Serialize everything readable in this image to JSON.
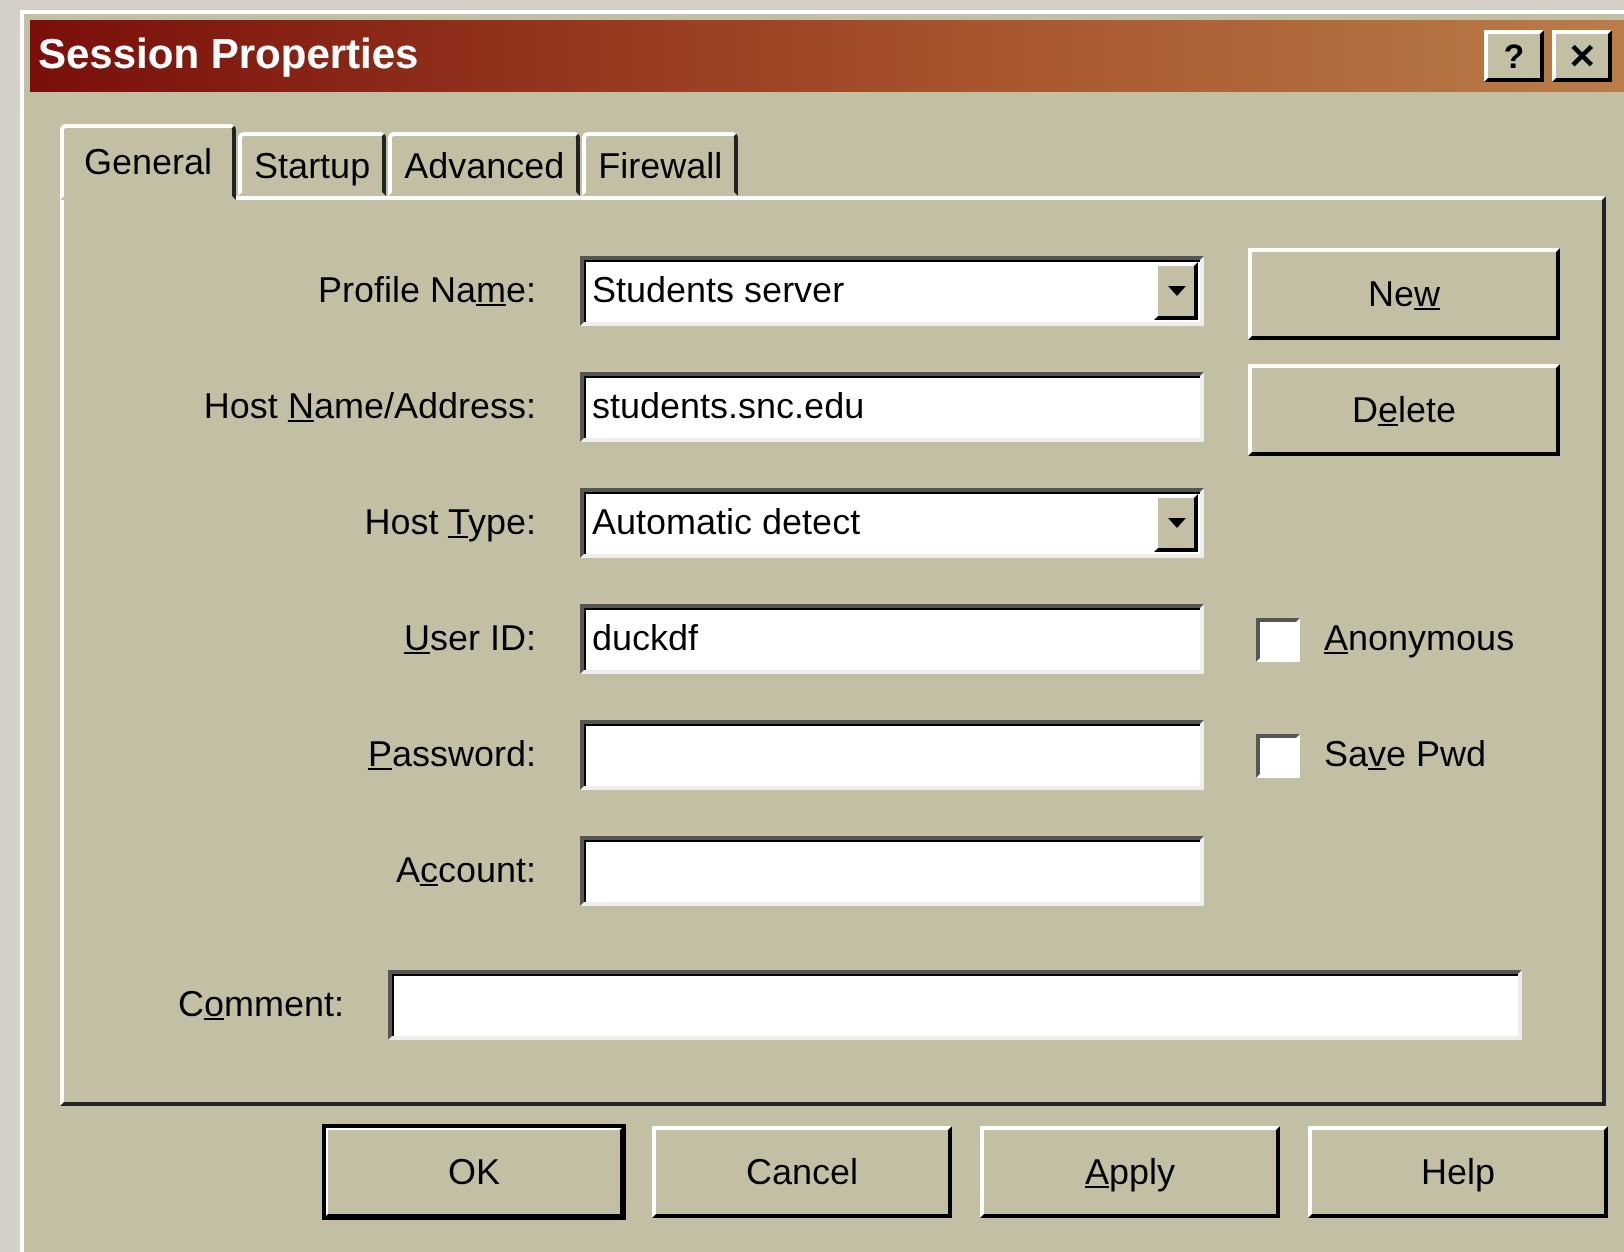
{
  "window": {
    "title": "Session Properties",
    "title_buttons": [
      "?",
      "✕"
    ]
  },
  "tabs": [
    {
      "label": "General",
      "selected": true
    },
    {
      "label": "Startup",
      "selected": false
    },
    {
      "label": "Advanced",
      "selected": false
    },
    {
      "label": "Firewall",
      "selected": false
    }
  ],
  "fields": [
    {
      "label": {
        "pre": "Profile Na",
        "key": "m",
        "post": "e:"
      },
      "kind": "combo",
      "value": "Students server"
    },
    {
      "label": {
        "pre": "Host ",
        "key": "N",
        "post": "ame/Address:"
      },
      "kind": "text",
      "value": "students.snc.edu"
    },
    {
      "label": {
        "pre": "Host ",
        "key": "T",
        "post": "ype:"
      },
      "kind": "combo",
      "value": "Automatic detect"
    },
    {
      "label": {
        "key": "U",
        "post": "ser ID:"
      },
      "kind": "text",
      "value": "duckdf"
    },
    {
      "label": {
        "key": "P",
        "post": "assword:"
      },
      "kind": "text"
    },
    {
      "label": {
        "pre": "A",
        "key": "c",
        "post": "count:"
      },
      "kind": "text"
    }
  ],
  "side_buttons": [
    {
      "label": {
        "pre": "Ne",
        "key": "w"
      }
    },
    {
      "label": {
        "pre": "D",
        "key": "e",
        "post": "lete"
      }
    }
  ],
  "checkboxes": [
    {
      "label": {
        "key": "A",
        "post": "nonymous"
      },
      "checked": false
    },
    {
      "label": {
        "pre": "Sa",
        "key": "v",
        "post": "e Pwd"
      },
      "checked": false
    }
  ],
  "comment": {
    "label": {
      "pre": "C",
      "key": "o",
      "post": "mment:"
    }
  },
  "buttons": [
    {
      "label": {
        "pre": "OK"
      },
      "default": true
    },
    {
      "label": {
        "pre": "Cancel"
      },
      "default": false
    },
    {
      "label": {
        "key": "A",
        "post": "pply"
      },
      "default": false
    },
    {
      "label": {
        "pre": "Help"
      },
      "default": false
    }
  ]
}
